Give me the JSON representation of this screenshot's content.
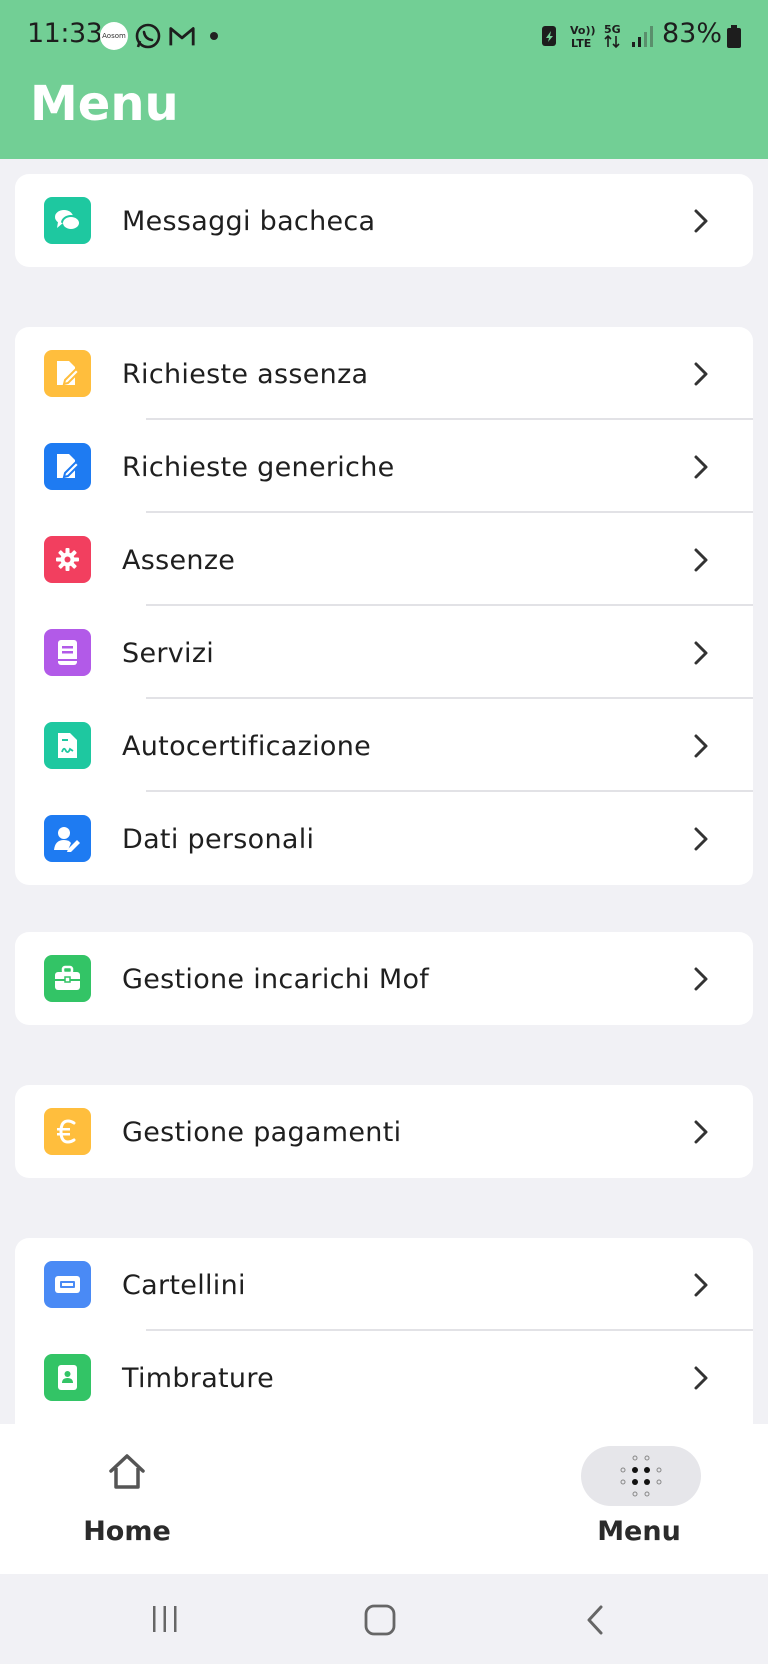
{
  "status_bar": {
    "time": "11:33",
    "app_icon_text": "Aosom",
    "battery": "83%"
  },
  "header": {
    "title": "Menu",
    "color": "#72cf95"
  },
  "groups": [
    {
      "items": [
        {
          "label": "Messaggi bacheca",
          "icon": "chat-bubbles-icon",
          "color": "#1ec8a0"
        }
      ]
    },
    {
      "items": [
        {
          "label": "Richieste assenza",
          "icon": "document-edit-icon",
          "color": "#ffbe3d"
        },
        {
          "label": "Richieste generiche",
          "icon": "document-edit-icon",
          "color": "#1e7bf2"
        },
        {
          "label": "Assenze",
          "icon": "gear-icon",
          "color": "#f23f5f"
        },
        {
          "label": "Servizi",
          "icon": "book-icon",
          "color": "#b25ae8"
        },
        {
          "label": "Autocertificazione",
          "icon": "signed-document-icon",
          "color": "#1ec8a0"
        },
        {
          "label": "Dati personali",
          "icon": "user-edit-icon",
          "color": "#1e7bf2"
        }
      ]
    },
    {
      "items": [
        {
          "label": "Gestione incarichi Mof",
          "icon": "briefcase-icon",
          "color": "#33c466"
        }
      ]
    },
    {
      "items": [
        {
          "label": "Gestione pagamenti",
          "icon": "euro-icon",
          "color": "#ffbe3d"
        }
      ]
    },
    {
      "items": [
        {
          "label": "Cartellini",
          "icon": "card-icon",
          "color": "#4a8af5"
        },
        {
          "label": "Timbrature",
          "icon": "badge-icon",
          "color": "#33c466"
        }
      ]
    }
  ],
  "bottom_nav": {
    "home_label": "Home",
    "menu_label": "Menu",
    "active": "Menu"
  }
}
